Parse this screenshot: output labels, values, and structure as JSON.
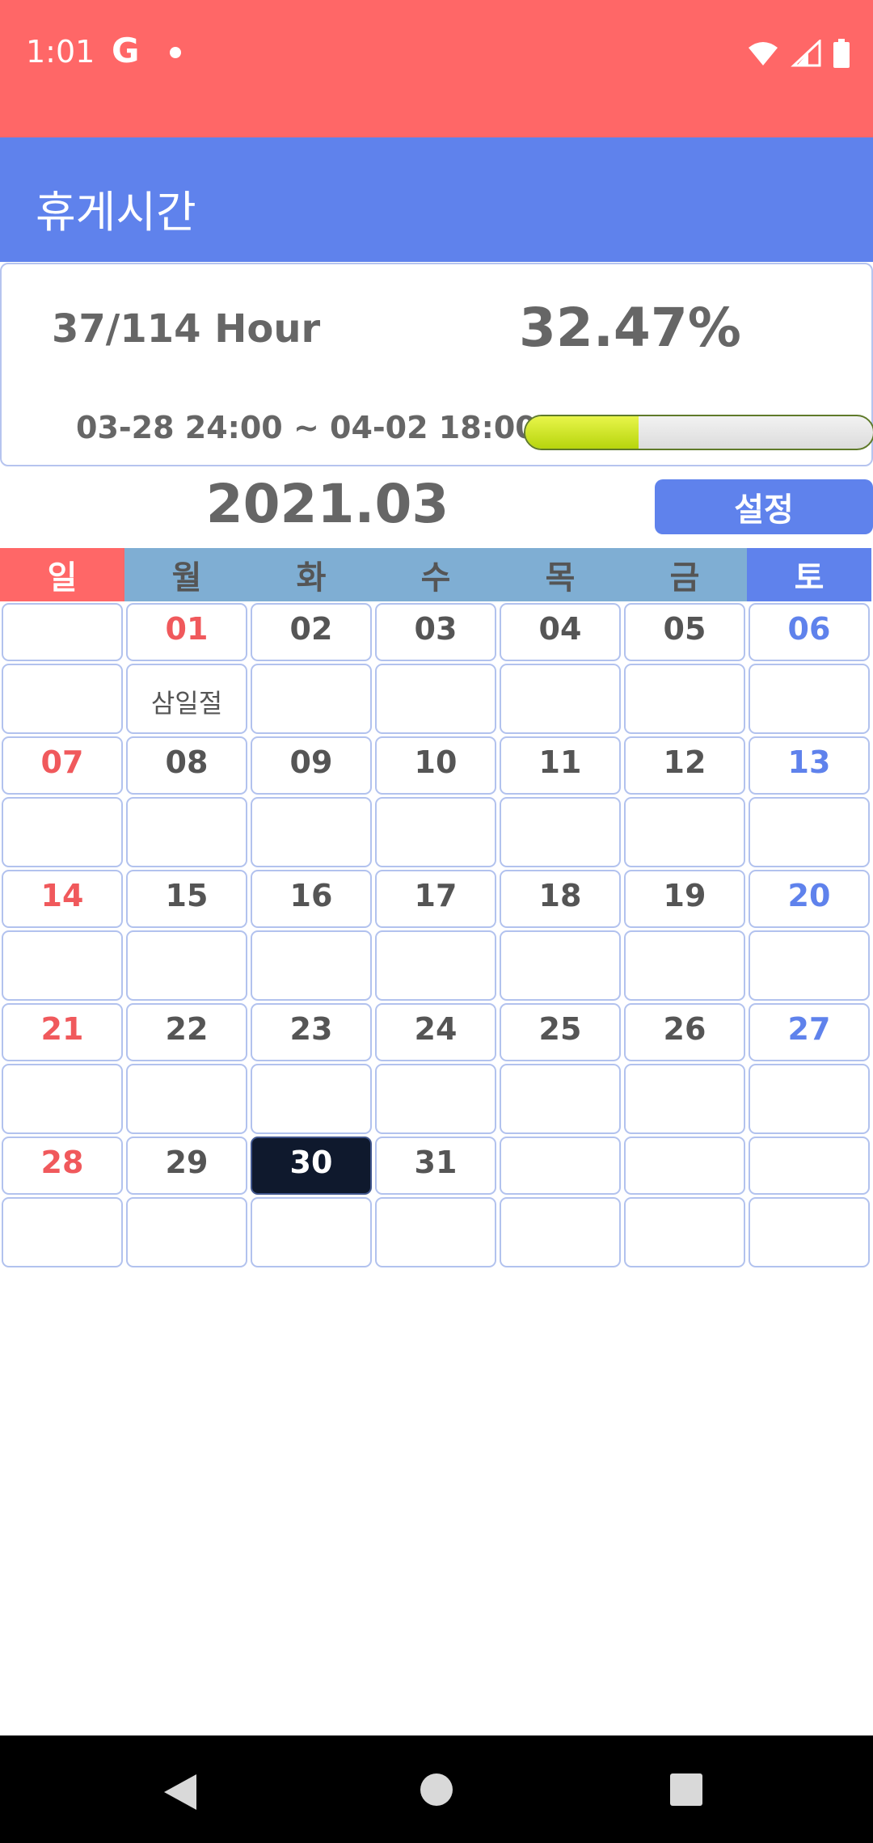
{
  "status_bar": {
    "time": "1:01",
    "google_glyph": "G",
    "icons": [
      "google-icon",
      "notification-dot-icon",
      "wifi-icon",
      "signal-icon",
      "battery-icon"
    ]
  },
  "app_bar": {
    "title": "휴게시간"
  },
  "summary": {
    "hours": "37/114 Hour",
    "percent": "32.47%",
    "range": "03-28 24:00 ~ 04-02 18:00",
    "progress_fraction": 0.3247
  },
  "calendar_header": {
    "month": "2021.03",
    "settings_label": "설정"
  },
  "weekdays": [
    "일",
    "월",
    "화",
    "수",
    "목",
    "금",
    "토"
  ],
  "weeks": [
    [
      {
        "day": ""
      },
      {
        "day": "01",
        "holiday": "삼일절",
        "red": true
      },
      {
        "day": "02"
      },
      {
        "day": "03"
      },
      {
        "day": "04"
      },
      {
        "day": "05"
      },
      {
        "day": "06"
      }
    ],
    [
      {
        "day": "07"
      },
      {
        "day": "08"
      },
      {
        "day": "09"
      },
      {
        "day": "10"
      },
      {
        "day": "11"
      },
      {
        "day": "12"
      },
      {
        "day": "13"
      }
    ],
    [
      {
        "day": "14"
      },
      {
        "day": "15"
      },
      {
        "day": "16"
      },
      {
        "day": "17"
      },
      {
        "day": "18"
      },
      {
        "day": "19"
      },
      {
        "day": "20"
      }
    ],
    [
      {
        "day": "21"
      },
      {
        "day": "22"
      },
      {
        "day": "23"
      },
      {
        "day": "24"
      },
      {
        "day": "25"
      },
      {
        "day": "26"
      },
      {
        "day": "27"
      }
    ],
    [
      {
        "day": "28"
      },
      {
        "day": "29"
      },
      {
        "day": "30",
        "today": true
      },
      {
        "day": "31"
      },
      {
        "day": ""
      },
      {
        "day": ""
      },
      {
        "day": ""
      }
    ]
  ],
  "colors": {
    "status_bar": "#ff6767",
    "app_bar": "#5f82ec",
    "sunday": "#f0595c",
    "saturday": "#5f82ec",
    "weekday_header": "#7faed3",
    "today": "#0f192d",
    "progress": "#c8e020"
  },
  "nav_bar": {
    "icons": [
      "back-icon",
      "home-icon",
      "recents-icon"
    ]
  }
}
